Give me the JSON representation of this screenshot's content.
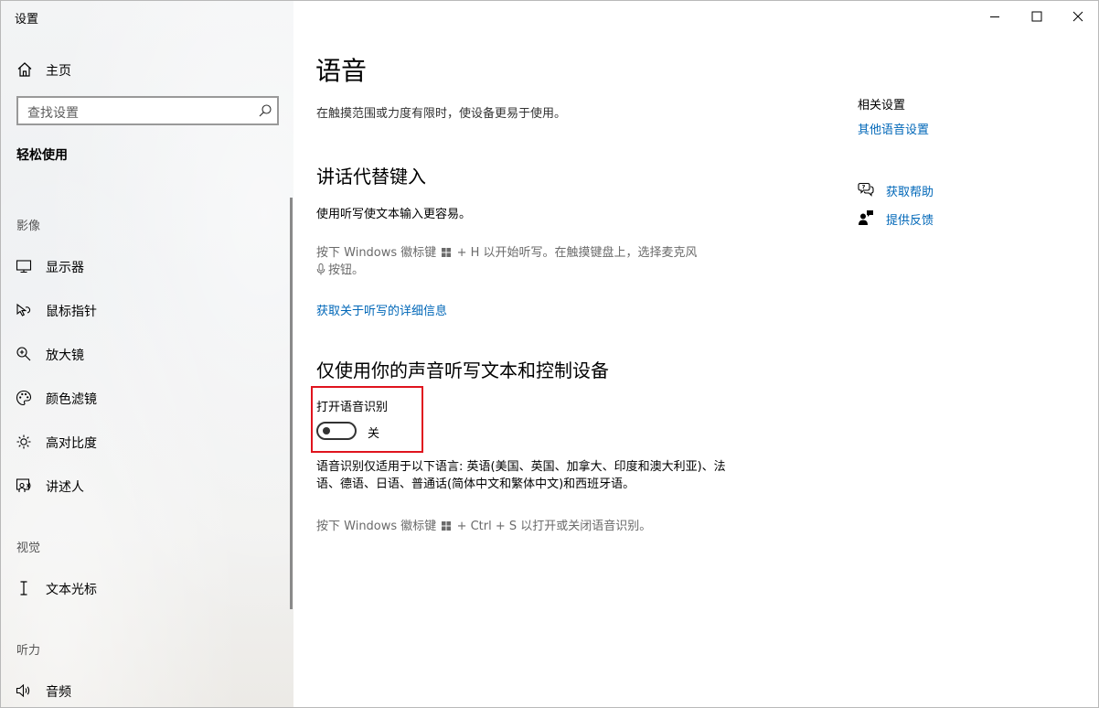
{
  "window": {
    "title": "设置"
  },
  "sidebar": {
    "home_label": "主页",
    "search_placeholder": "查找设置",
    "category": "轻松使用",
    "groups": [
      {
        "header": "影像",
        "items": [
          {
            "label": "显示器",
            "icon": "monitor-icon"
          },
          {
            "label": "鼠标指针",
            "icon": "mouse-pointer-icon"
          },
          {
            "label": "放大镜",
            "icon": "magnifier-icon"
          },
          {
            "label": "颜色滤镜",
            "icon": "color-filter-icon"
          },
          {
            "label": "高对比度",
            "icon": "high-contrast-icon"
          },
          {
            "label": "讲述人",
            "icon": "narrator-icon"
          }
        ]
      },
      {
        "header": "视觉",
        "items": [
          {
            "label": "文本光标",
            "icon": "text-cursor-icon"
          }
        ]
      },
      {
        "header": "听力",
        "items": [
          {
            "label": "音频",
            "icon": "audio-icon"
          }
        ]
      }
    ]
  },
  "main": {
    "title": "语音",
    "description": "在触摸范围或力度有限时，使设备更易于使用。",
    "section1": {
      "title": "讲话代替键入",
      "text": "使用听写使文本输入更容易。",
      "hint_part1": "按下 Windows 徽标键",
      "hint_part2": "+ H 以开始听写。在触摸键盘上，选择麦克风",
      "hint_part3": "按钮。",
      "link": "获取关于听写的详细信息"
    },
    "section2": {
      "title": "仅使用你的声音听写文本和控制设备",
      "toggle_label": "打开语音识别",
      "toggle_state": "关",
      "toggle_on": false,
      "note": "语音识别仅适用于以下语言: 英语(美国、英国、加拿大、印度和澳大利亚)、法语、德语、日语、普通话(简体中文和繁体中文)和西班牙语。",
      "hint_part1": "按下 Windows 徽标键",
      "hint_part2": "+ Ctrl + S 以打开或关闭语音识别。"
    },
    "related": {
      "title": "相关设置",
      "link": "其他语音设置",
      "help": "获取帮助",
      "feedback": "提供反馈"
    }
  },
  "colors": {
    "accent": "#0067b8",
    "highlight": "#e0141e"
  }
}
